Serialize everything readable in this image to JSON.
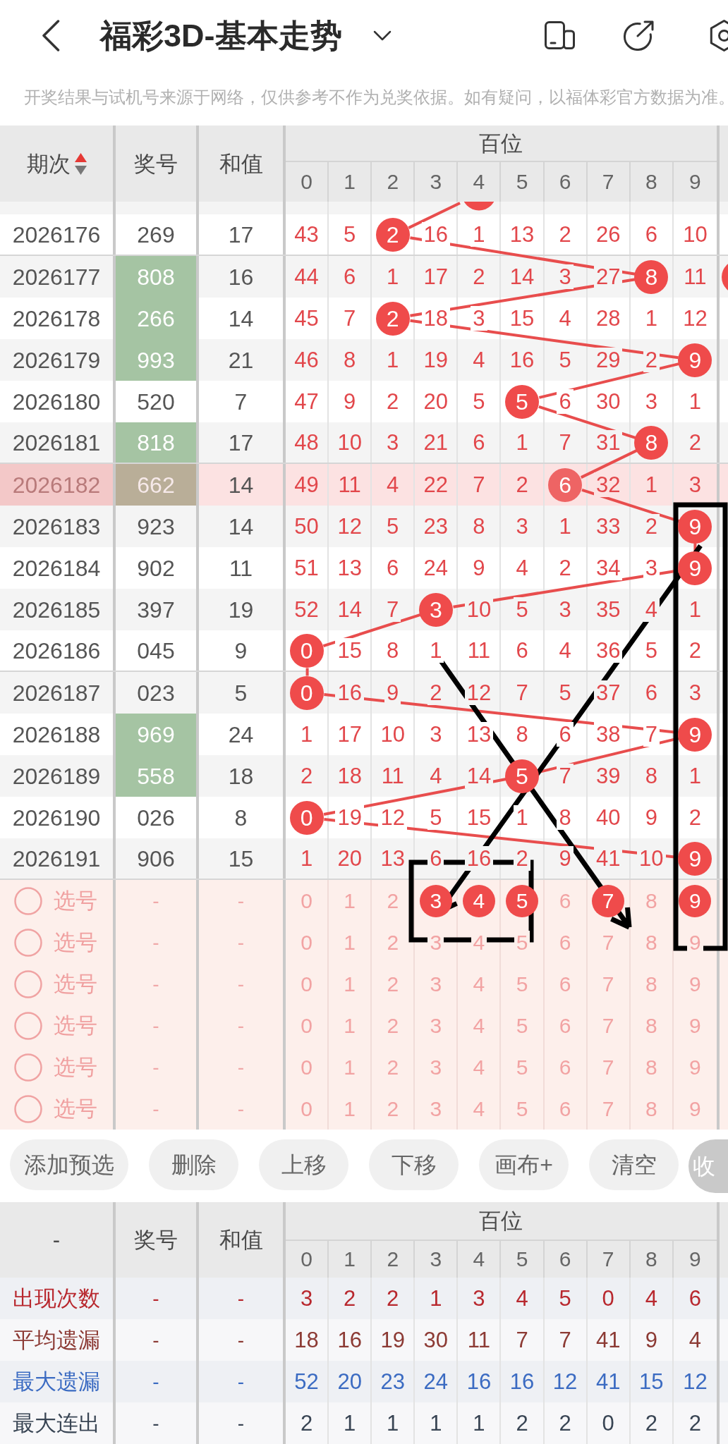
{
  "header": {
    "title": "福彩3D-基本走势"
  },
  "notice": "开奖结果与试机号来源于网络，仅供参考不作为兑奖依据。如有疑问，以福体彩官方数据为准。",
  "trend_table": {
    "columns": [
      {
        "label": "期次",
        "sort_ascending": true
      },
      {
        "label": "奖号"
      },
      {
        "label": "和值"
      }
    ],
    "group": "百位",
    "digits": [
      "0",
      "1",
      "2",
      "3",
      "4",
      "5",
      "6",
      "7",
      "8",
      "9"
    ],
    "partial_row": {
      "hits": [
        false,
        false,
        false,
        false,
        true,
        false,
        false,
        false,
        false,
        false
      ]
    },
    "rows": [
      {
        "period": "2026176",
        "number": "269",
        "number_marked": false,
        "sum": "17",
        "highlighted": false,
        "separator_below": true,
        "edge_hit": false,
        "cells": [
          {
            "text": "43",
            "hit": false
          },
          {
            "text": "5",
            "hit": false
          },
          {
            "text": "2",
            "hit": true
          },
          {
            "text": "16",
            "hit": false
          },
          {
            "text": "1",
            "hit": false
          },
          {
            "text": "13",
            "hit": false
          },
          {
            "text": "2",
            "hit": false
          },
          {
            "text": "26",
            "hit": false
          },
          {
            "text": "6",
            "hit": false
          },
          {
            "text": "10",
            "hit": false
          }
        ]
      },
      {
        "period": "2026177",
        "number": "808",
        "number_marked": true,
        "sum": "16",
        "highlighted": false,
        "separator_below": false,
        "edge_hit": true,
        "cells": [
          {
            "text": "44",
            "hit": false
          },
          {
            "text": "6",
            "hit": false
          },
          {
            "text": "1",
            "hit": false
          },
          {
            "text": "17",
            "hit": false
          },
          {
            "text": "2",
            "hit": false
          },
          {
            "text": "14",
            "hit": false
          },
          {
            "text": "3",
            "hit": false
          },
          {
            "text": "27",
            "hit": false
          },
          {
            "text": "8",
            "hit": true
          },
          {
            "text": "11",
            "hit": false
          }
        ]
      },
      {
        "period": "2026178",
        "number": "266",
        "number_marked": true,
        "sum": "14",
        "highlighted": false,
        "separator_below": false,
        "edge_hit": false,
        "cells": [
          {
            "text": "45",
            "hit": false
          },
          {
            "text": "7",
            "hit": false
          },
          {
            "text": "2",
            "hit": true
          },
          {
            "text": "18",
            "hit": false
          },
          {
            "text": "3",
            "hit": false
          },
          {
            "text": "15",
            "hit": false
          },
          {
            "text": "4",
            "hit": false
          },
          {
            "text": "28",
            "hit": false
          },
          {
            "text": "1",
            "hit": false
          },
          {
            "text": "12",
            "hit": false
          }
        ]
      },
      {
        "period": "2026179",
        "number": "993",
        "number_marked": true,
        "sum": "21",
        "highlighted": false,
        "separator_below": false,
        "edge_hit": false,
        "cells": [
          {
            "text": "46",
            "hit": false
          },
          {
            "text": "8",
            "hit": false
          },
          {
            "text": "1",
            "hit": false
          },
          {
            "text": "19",
            "hit": false
          },
          {
            "text": "4",
            "hit": false
          },
          {
            "text": "16",
            "hit": false
          },
          {
            "text": "5",
            "hit": false
          },
          {
            "text": "29",
            "hit": false
          },
          {
            "text": "2",
            "hit": false
          },
          {
            "text": "9",
            "hit": true
          }
        ]
      },
      {
        "period": "2026180",
        "number": "520",
        "number_marked": false,
        "sum": "7",
        "highlighted": false,
        "separator_below": false,
        "edge_hit": false,
        "cells": [
          {
            "text": "47",
            "hit": false
          },
          {
            "text": "9",
            "hit": false
          },
          {
            "text": "2",
            "hit": false
          },
          {
            "text": "20",
            "hit": false
          },
          {
            "text": "5",
            "hit": false
          },
          {
            "text": "5",
            "hit": true
          },
          {
            "text": "6",
            "hit": false
          },
          {
            "text": "30",
            "hit": false
          },
          {
            "text": "3",
            "hit": false
          },
          {
            "text": "1",
            "hit": false
          }
        ]
      },
      {
        "period": "2026181",
        "number": "818",
        "number_marked": true,
        "sum": "17",
        "highlighted": false,
        "separator_below": true,
        "edge_hit": false,
        "cells": [
          {
            "text": "48",
            "hit": false
          },
          {
            "text": "10",
            "hit": false
          },
          {
            "text": "3",
            "hit": false
          },
          {
            "text": "21",
            "hit": false
          },
          {
            "text": "6",
            "hit": false
          },
          {
            "text": "1",
            "hit": false
          },
          {
            "text": "7",
            "hit": false
          },
          {
            "text": "31",
            "hit": false
          },
          {
            "text": "8",
            "hit": true
          },
          {
            "text": "2",
            "hit": false
          }
        ]
      },
      {
        "period": "2026182",
        "number": "662",
        "number_marked": true,
        "sum": "14",
        "highlighted": true,
        "separator_below": false,
        "edge_hit": false,
        "cells": [
          {
            "text": "49",
            "hit": false
          },
          {
            "text": "11",
            "hit": false
          },
          {
            "text": "4",
            "hit": false
          },
          {
            "text": "22",
            "hit": false
          },
          {
            "text": "7",
            "hit": false
          },
          {
            "text": "2",
            "hit": false
          },
          {
            "text": "6",
            "hit": true
          },
          {
            "text": "32",
            "hit": false
          },
          {
            "text": "1",
            "hit": false
          },
          {
            "text": "3",
            "hit": false
          }
        ]
      },
      {
        "period": "2026183",
        "number": "923",
        "number_marked": false,
        "sum": "14",
        "highlighted": false,
        "separator_below": false,
        "edge_hit": false,
        "cells": [
          {
            "text": "50",
            "hit": false
          },
          {
            "text": "12",
            "hit": false
          },
          {
            "text": "5",
            "hit": false
          },
          {
            "text": "23",
            "hit": false
          },
          {
            "text": "8",
            "hit": false
          },
          {
            "text": "3",
            "hit": false
          },
          {
            "text": "1",
            "hit": false
          },
          {
            "text": "33",
            "hit": false
          },
          {
            "text": "2",
            "hit": false
          },
          {
            "text": "9",
            "hit": true
          }
        ]
      },
      {
        "period": "2026184",
        "number": "902",
        "number_marked": false,
        "sum": "11",
        "highlighted": false,
        "separator_below": false,
        "edge_hit": false,
        "cells": [
          {
            "text": "51",
            "hit": false
          },
          {
            "text": "13",
            "hit": false
          },
          {
            "text": "6",
            "hit": false
          },
          {
            "text": "24",
            "hit": false
          },
          {
            "text": "9",
            "hit": false
          },
          {
            "text": "4",
            "hit": false
          },
          {
            "text": "2",
            "hit": false
          },
          {
            "text": "34",
            "hit": false
          },
          {
            "text": "3",
            "hit": false
          },
          {
            "text": "9",
            "hit": true
          }
        ]
      },
      {
        "period": "2026185",
        "number": "397",
        "number_marked": false,
        "sum": "19",
        "highlighted": false,
        "separator_below": false,
        "edge_hit": false,
        "cells": [
          {
            "text": "52",
            "hit": false
          },
          {
            "text": "14",
            "hit": false
          },
          {
            "text": "7",
            "hit": false
          },
          {
            "text": "3",
            "hit": true
          },
          {
            "text": "10",
            "hit": false
          },
          {
            "text": "5",
            "hit": false
          },
          {
            "text": "3",
            "hit": false
          },
          {
            "text": "35",
            "hit": false
          },
          {
            "text": "4",
            "hit": false
          },
          {
            "text": "1",
            "hit": false
          }
        ]
      },
      {
        "period": "2026186",
        "number": "045",
        "number_marked": false,
        "sum": "9",
        "highlighted": false,
        "separator_below": true,
        "edge_hit": false,
        "cells": [
          {
            "text": "0",
            "hit": true
          },
          {
            "text": "15",
            "hit": false
          },
          {
            "text": "8",
            "hit": false
          },
          {
            "text": "1",
            "hit": false
          },
          {
            "text": "11",
            "hit": false
          },
          {
            "text": "6",
            "hit": false
          },
          {
            "text": "4",
            "hit": false
          },
          {
            "text": "36",
            "hit": false
          },
          {
            "text": "5",
            "hit": false
          },
          {
            "text": "2",
            "hit": false
          }
        ]
      },
      {
        "period": "2026187",
        "number": "023",
        "number_marked": false,
        "sum": "5",
        "highlighted": false,
        "separator_below": false,
        "edge_hit": false,
        "cells": [
          {
            "text": "0",
            "hit": true
          },
          {
            "text": "16",
            "hit": false
          },
          {
            "text": "9",
            "hit": false
          },
          {
            "text": "2",
            "hit": false
          },
          {
            "text": "12",
            "hit": false
          },
          {
            "text": "7",
            "hit": false
          },
          {
            "text": "5",
            "hit": false
          },
          {
            "text": "37",
            "hit": false
          },
          {
            "text": "6",
            "hit": false
          },
          {
            "text": "3",
            "hit": false
          }
        ]
      },
      {
        "period": "2026188",
        "number": "969",
        "number_marked": true,
        "sum": "24",
        "highlighted": false,
        "separator_below": false,
        "edge_hit": false,
        "cells": [
          {
            "text": "1",
            "hit": false
          },
          {
            "text": "17",
            "hit": false
          },
          {
            "text": "10",
            "hit": false
          },
          {
            "text": "3",
            "hit": false
          },
          {
            "text": "13",
            "hit": false
          },
          {
            "text": "8",
            "hit": false
          },
          {
            "text": "6",
            "hit": false
          },
          {
            "text": "38",
            "hit": false
          },
          {
            "text": "7",
            "hit": false
          },
          {
            "text": "9",
            "hit": true
          }
        ]
      },
      {
        "period": "2026189",
        "number": "558",
        "number_marked": true,
        "sum": "18",
        "highlighted": false,
        "separator_below": false,
        "edge_hit": false,
        "cells": [
          {
            "text": "2",
            "hit": false
          },
          {
            "text": "18",
            "hit": false
          },
          {
            "text": "11",
            "hit": false
          },
          {
            "text": "4",
            "hit": false
          },
          {
            "text": "14",
            "hit": false
          },
          {
            "text": "5",
            "hit": true
          },
          {
            "text": "7",
            "hit": false
          },
          {
            "text": "39",
            "hit": false
          },
          {
            "text": "8",
            "hit": false
          },
          {
            "text": "1",
            "hit": false
          }
        ]
      },
      {
        "period": "2026190",
        "number": "026",
        "number_marked": false,
        "sum": "8",
        "highlighted": false,
        "separator_below": false,
        "edge_hit": false,
        "cells": [
          {
            "text": "0",
            "hit": true
          },
          {
            "text": "19",
            "hit": false
          },
          {
            "text": "12",
            "hit": false
          },
          {
            "text": "5",
            "hit": false
          },
          {
            "text": "15",
            "hit": false
          },
          {
            "text": "1",
            "hit": false
          },
          {
            "text": "8",
            "hit": false
          },
          {
            "text": "40",
            "hit": false
          },
          {
            "text": "9",
            "hit": false
          },
          {
            "text": "2",
            "hit": false
          }
        ]
      },
      {
        "period": "2026191",
        "number": "906",
        "number_marked": false,
        "sum": "15",
        "highlighted": false,
        "separator_below": true,
        "edge_hit": false,
        "cells": [
          {
            "text": "1",
            "hit": false
          },
          {
            "text": "20",
            "hit": false
          },
          {
            "text": "13",
            "hit": false
          },
          {
            "text": "6",
            "hit": false
          },
          {
            "text": "16",
            "hit": false
          },
          {
            "text": "2",
            "hit": false
          },
          {
            "text": "9",
            "hit": false
          },
          {
            "text": "41",
            "hit": false
          },
          {
            "text": "10",
            "hit": false
          },
          {
            "text": "9",
            "hit": true
          }
        ]
      }
    ],
    "pick_rows": [
      {
        "checked": false,
        "label": "选号",
        "number": "-",
        "sum": "-",
        "digits": [
          {
            "text": "0",
            "selected": false
          },
          {
            "text": "1",
            "selected": false
          },
          {
            "text": "2",
            "selected": false
          },
          {
            "text": "3",
            "selected": true
          },
          {
            "text": "4",
            "selected": true
          },
          {
            "text": "5",
            "selected": true
          },
          {
            "text": "6",
            "selected": false
          },
          {
            "text": "7",
            "selected": true
          },
          {
            "text": "8",
            "selected": false
          },
          {
            "text": "9",
            "selected": true
          }
        ]
      },
      {
        "checked": false,
        "label": "选号",
        "number": "-",
        "sum": "-",
        "digits": [
          {
            "text": "0",
            "selected": false
          },
          {
            "text": "1",
            "selected": false
          },
          {
            "text": "2",
            "selected": false
          },
          {
            "text": "3",
            "selected": false
          },
          {
            "text": "4",
            "selected": false
          },
          {
            "text": "5",
            "selected": false
          },
          {
            "text": "6",
            "selected": false
          },
          {
            "text": "7",
            "selected": false
          },
          {
            "text": "8",
            "selected": false
          },
          {
            "text": "9",
            "selected": false
          }
        ]
      },
      {
        "checked": false,
        "label": "选号",
        "number": "-",
        "sum": "-",
        "digits": [
          {
            "text": "0",
            "selected": false
          },
          {
            "text": "1",
            "selected": false
          },
          {
            "text": "2",
            "selected": false
          },
          {
            "text": "3",
            "selected": false
          },
          {
            "text": "4",
            "selected": false
          },
          {
            "text": "5",
            "selected": false
          },
          {
            "text": "6",
            "selected": false
          },
          {
            "text": "7",
            "selected": false
          },
          {
            "text": "8",
            "selected": false
          },
          {
            "text": "9",
            "selected": false
          }
        ]
      },
      {
        "checked": false,
        "label": "选号",
        "number": "-",
        "sum": "-",
        "digits": [
          {
            "text": "0",
            "selected": false
          },
          {
            "text": "1",
            "selected": false
          },
          {
            "text": "2",
            "selected": false
          },
          {
            "text": "3",
            "selected": false
          },
          {
            "text": "4",
            "selected": false
          },
          {
            "text": "5",
            "selected": false
          },
          {
            "text": "6",
            "selected": false
          },
          {
            "text": "7",
            "selected": false
          },
          {
            "text": "8",
            "selected": false
          },
          {
            "text": "9",
            "selected": false
          }
        ]
      },
      {
        "checked": false,
        "label": "选号",
        "number": "-",
        "sum": "-",
        "digits": [
          {
            "text": "0",
            "selected": false
          },
          {
            "text": "1",
            "selected": false
          },
          {
            "text": "2",
            "selected": false
          },
          {
            "text": "3",
            "selected": false
          },
          {
            "text": "4",
            "selected": false
          },
          {
            "text": "5",
            "selected": false
          },
          {
            "text": "6",
            "selected": false
          },
          {
            "text": "7",
            "selected": false
          },
          {
            "text": "8",
            "selected": false
          },
          {
            "text": "9",
            "selected": false
          }
        ]
      },
      {
        "checked": false,
        "label": "选号",
        "number": "-",
        "sum": "-",
        "digits": [
          {
            "text": "0",
            "selected": false
          },
          {
            "text": "1",
            "selected": false
          },
          {
            "text": "2",
            "selected": false
          },
          {
            "text": "3",
            "selected": false
          },
          {
            "text": "4",
            "selected": false
          },
          {
            "text": "5",
            "selected": false
          },
          {
            "text": "6",
            "selected": false
          },
          {
            "text": "7",
            "selected": false
          },
          {
            "text": "8",
            "selected": false
          },
          {
            "text": "9",
            "selected": false
          }
        ]
      }
    ]
  },
  "actions": [
    {
      "label": "添加预选",
      "kind": "pill"
    },
    {
      "label": "删除",
      "kind": "pill"
    },
    {
      "label": "上移",
      "kind": "pill"
    },
    {
      "label": "下移",
      "kind": "pill"
    },
    {
      "label": "画布+",
      "kind": "pill"
    },
    {
      "label": "清空",
      "kind": "pill"
    },
    {
      "label": "收",
      "kind": "filled"
    }
  ],
  "stats_table": {
    "columns": [
      {
        "label": "-"
      },
      {
        "label": "奖号"
      },
      {
        "label": "和值"
      }
    ],
    "group": "百位",
    "digits": [
      "0",
      "1",
      "2",
      "3",
      "4",
      "5",
      "6",
      "7",
      "8",
      "9"
    ],
    "rows": [
      {
        "label": "出现次数",
        "color": "#b8282e",
        "number": "-",
        "sum": "-",
        "values": [
          "3",
          "2",
          "2",
          "1",
          "3",
          "4",
          "5",
          "0",
          "4",
          "6"
        ]
      },
      {
        "label": "平均遗漏",
        "color": "#8c3a34",
        "number": "-",
        "sum": "-",
        "values": [
          "18",
          "16",
          "19",
          "30",
          "11",
          "7",
          "7",
          "41",
          "9",
          "4"
        ]
      },
      {
        "label": "最大遗漏",
        "color": "#3b6bc2",
        "number": "-",
        "sum": "-",
        "values": [
          "52",
          "20",
          "23",
          "24",
          "16",
          "16",
          "12",
          "41",
          "15",
          "12"
        ]
      },
      {
        "label": "最大连出",
        "color": "#394554",
        "number": "-",
        "sum": "-",
        "values": [
          "2",
          "1",
          "1",
          "1",
          "1",
          "2",
          "2",
          "0",
          "2",
          "2"
        ]
      }
    ]
  }
}
